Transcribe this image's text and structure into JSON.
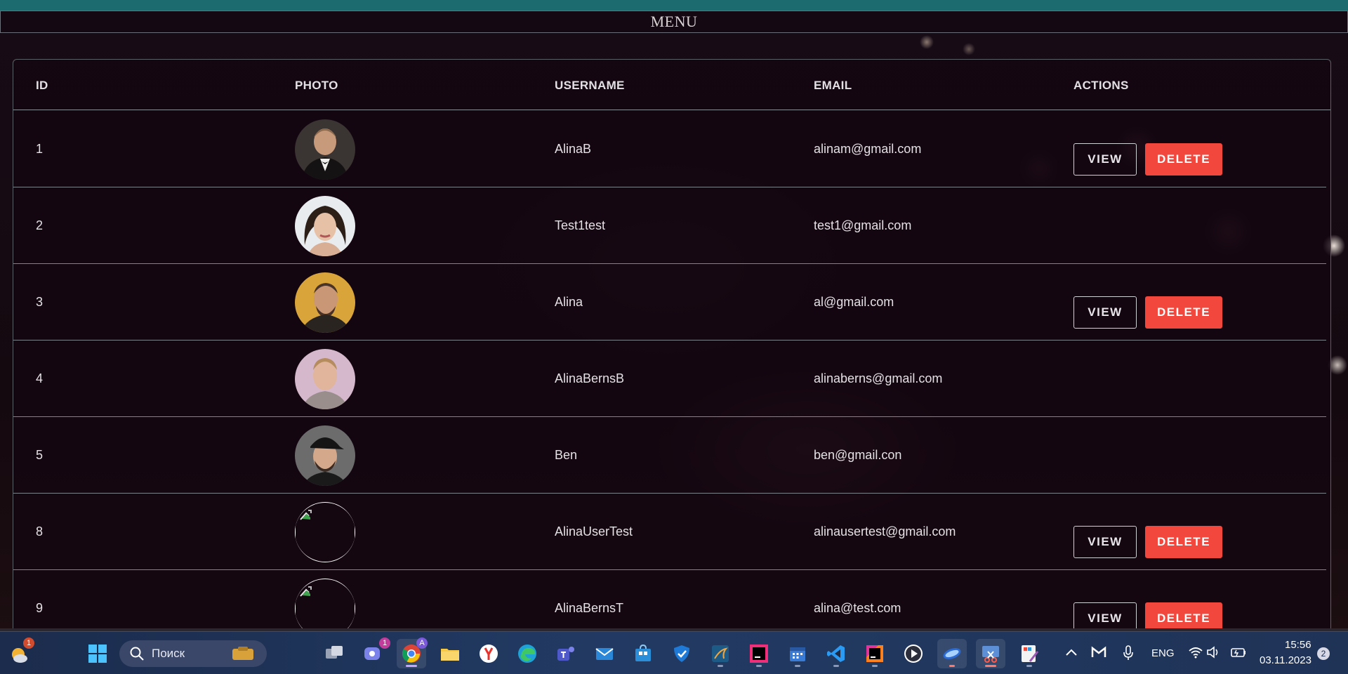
{
  "header": {
    "menu_label": "MENU"
  },
  "table": {
    "columns": [
      "ID",
      "PHOTO",
      "USERNAME",
      "EMAIL",
      "ACTIONS"
    ],
    "rows": [
      {
        "id": "1",
        "username": "AlinaB",
        "email": "alinam@gmail.com",
        "actions": [
          "VIEW",
          "DELETE"
        ],
        "photo": "photo-man-tuxedo"
      },
      {
        "id": "2",
        "username": "Test1test",
        "email": "test1@gmail.com",
        "actions": [],
        "photo": "photo-woman-dark-hair"
      },
      {
        "id": "3",
        "username": "Alina",
        "email": "al@gmail.com",
        "actions": [
          "VIEW",
          "DELETE"
        ],
        "photo": "photo-man-beard"
      },
      {
        "id": "4",
        "username": "AlinaBernsB",
        "email": "alinaberns@gmail.com",
        "actions": [],
        "photo": "photo-man-blond"
      },
      {
        "id": "5",
        "username": "Ben",
        "email": "ben@gmail.con",
        "actions": [],
        "photo": "photo-man-cap"
      },
      {
        "id": "8",
        "username": "AlinaUserTest",
        "email": "alinausertest@gmail.com",
        "actions": [
          "VIEW",
          "DELETE"
        ],
        "photo": "broken-image"
      },
      {
        "id": "9",
        "username": "AlinaBernsT",
        "email": "alina@test.com",
        "actions": [
          "VIEW",
          "DELETE"
        ],
        "photo": "broken-image"
      }
    ]
  },
  "taskbar": {
    "search_placeholder": "Поиск",
    "widgets_badge": "1",
    "teams_badge": "1",
    "chrome_badge": "A",
    "language": "ENG",
    "time": "15:56",
    "date": "03.11.2023",
    "notification_count": "2"
  },
  "colors": {
    "delete_button": "#f2473d",
    "top_bar": "#1c6b6e",
    "background": "#150910"
  }
}
